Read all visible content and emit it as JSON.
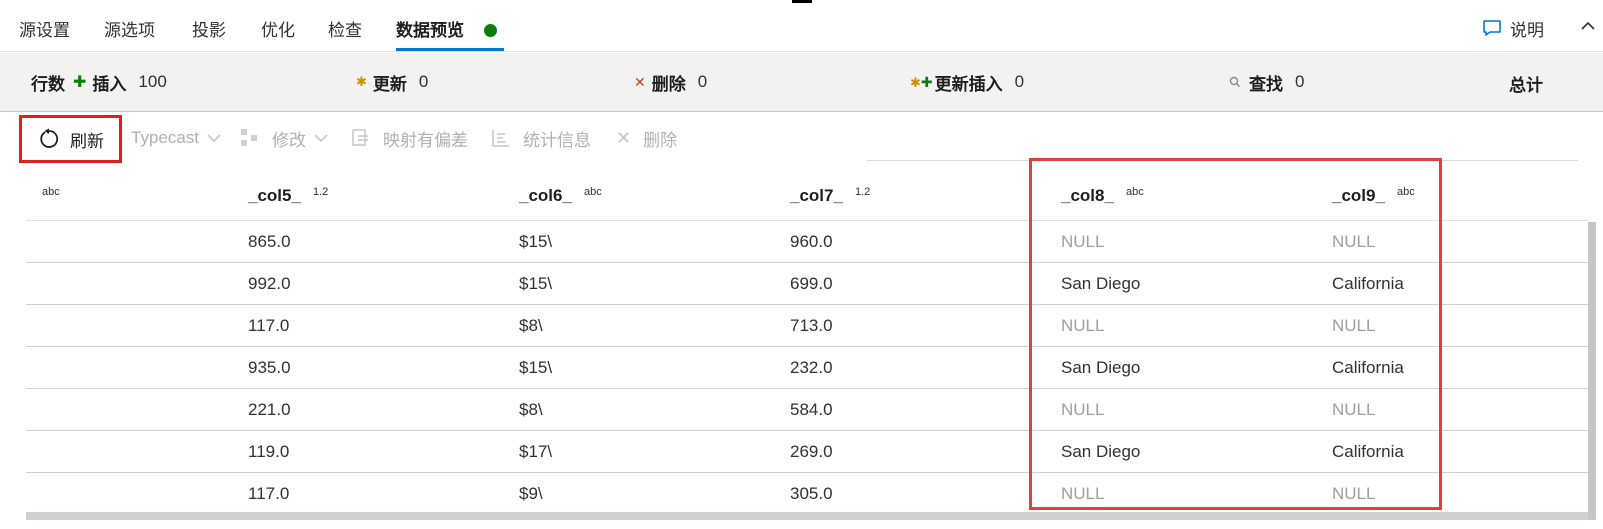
{
  "tabs": [
    {
      "label": "源设置"
    },
    {
      "label": "源选项"
    },
    {
      "label": "投影"
    },
    {
      "label": "优化"
    },
    {
      "label": "检查"
    },
    {
      "label": "数据预览"
    }
  ],
  "help": {
    "label": "说明"
  },
  "stats": {
    "rows_label": "行数",
    "insert": {
      "label": "插入",
      "value": "100"
    },
    "update": {
      "label": "更新",
      "value": "0"
    },
    "delete": {
      "label": "删除",
      "value": "0"
    },
    "upsert": {
      "label": "更新插入",
      "value": "0"
    },
    "lookup": {
      "label": "查找",
      "value": "0"
    },
    "total_label": "总计"
  },
  "toolbar": {
    "refresh": "刷新",
    "typecast": "Typecast",
    "modify": "修改",
    "map_drifted": "映射有偏差",
    "statistics": "统计信息",
    "remove": "删除"
  },
  "columns": [
    {
      "name": "",
      "type": "abc"
    },
    {
      "name": "_col5_",
      "type": "1.2"
    },
    {
      "name": "_col6_",
      "type": "abc"
    },
    {
      "name": "_col7_",
      "type": "1.2"
    },
    {
      "name": "_col8_",
      "type": "abc"
    },
    {
      "name": "_col9_",
      "type": "abc"
    }
  ],
  "rows": [
    [
      "865.0",
      "$15\\",
      "960.0",
      "NULL",
      "NULL"
    ],
    [
      "992.0",
      "$15\\",
      "699.0",
      "San Diego",
      "California"
    ],
    [
      "117.0",
      "$8\\",
      "713.0",
      "NULL",
      "NULL"
    ],
    [
      "935.0",
      "$15\\",
      "232.0",
      "San Diego",
      "California"
    ],
    [
      "221.0",
      "$8\\",
      "584.0",
      "NULL",
      "NULL"
    ],
    [
      "119.0",
      "$17\\",
      "269.0",
      "San Diego",
      "California"
    ],
    [
      "117.0",
      "$9\\",
      "305.0",
      "NULL",
      "NULL"
    ]
  ],
  "colors": {
    "accent": "#0078d4",
    "status_ok": "#107c10",
    "highlight": "#e02020"
  }
}
